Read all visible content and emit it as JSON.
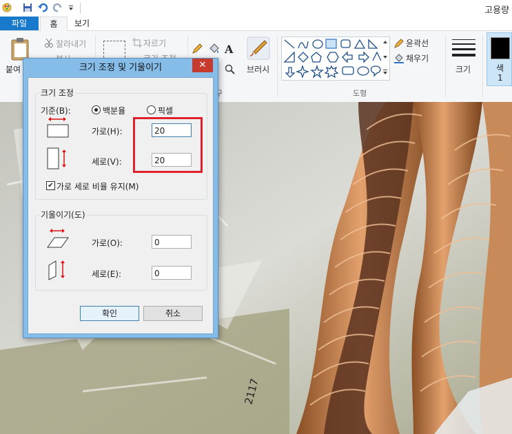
{
  "app": {
    "title": "고용량"
  },
  "tabs": [
    {
      "label": "파일"
    },
    {
      "label": "홈"
    },
    {
      "label": "보기"
    }
  ],
  "ribbon": {
    "paste": "붙여",
    "cut": "잘라내기",
    "copy": "복사",
    "crop": "자르기",
    "resize": "크기 조정",
    "brushes": "브러시",
    "outline": "윤곽선",
    "fill": "채우기",
    "size": "크기",
    "color1": "색\n1",
    "color1_a": "색",
    "color1_b": "1",
    "tools_group": "구",
    "shapes_group": "도형"
  },
  "dialog": {
    "title": "크기 조정 및 기울이기",
    "close": "✕",
    "resize_group": "크기 조정",
    "basis_label": "기준(B):",
    "percent_label": "백분율",
    "pixel_label": "픽셀",
    "percent_selected": true,
    "horizontal_label": "가로(H):",
    "horizontal_value": "20",
    "vertical_label": "세로(V):",
    "vertical_value": "20",
    "keep_ratio_label": "가로 세로 비율 유지(M)",
    "keep_ratio_checked": true,
    "skew_group": "기울이기(도)",
    "skew_h_label": "가로(O):",
    "skew_h_value": "0",
    "skew_v_label": "세로(E):",
    "skew_v_value": "0",
    "ok": "확인",
    "cancel": "취소"
  },
  "canvas": {
    "label_text": "2117"
  },
  "colors": {
    "accent": "#1979ca",
    "highlight": "#e0212b",
    "close": "#c73a2e"
  }
}
